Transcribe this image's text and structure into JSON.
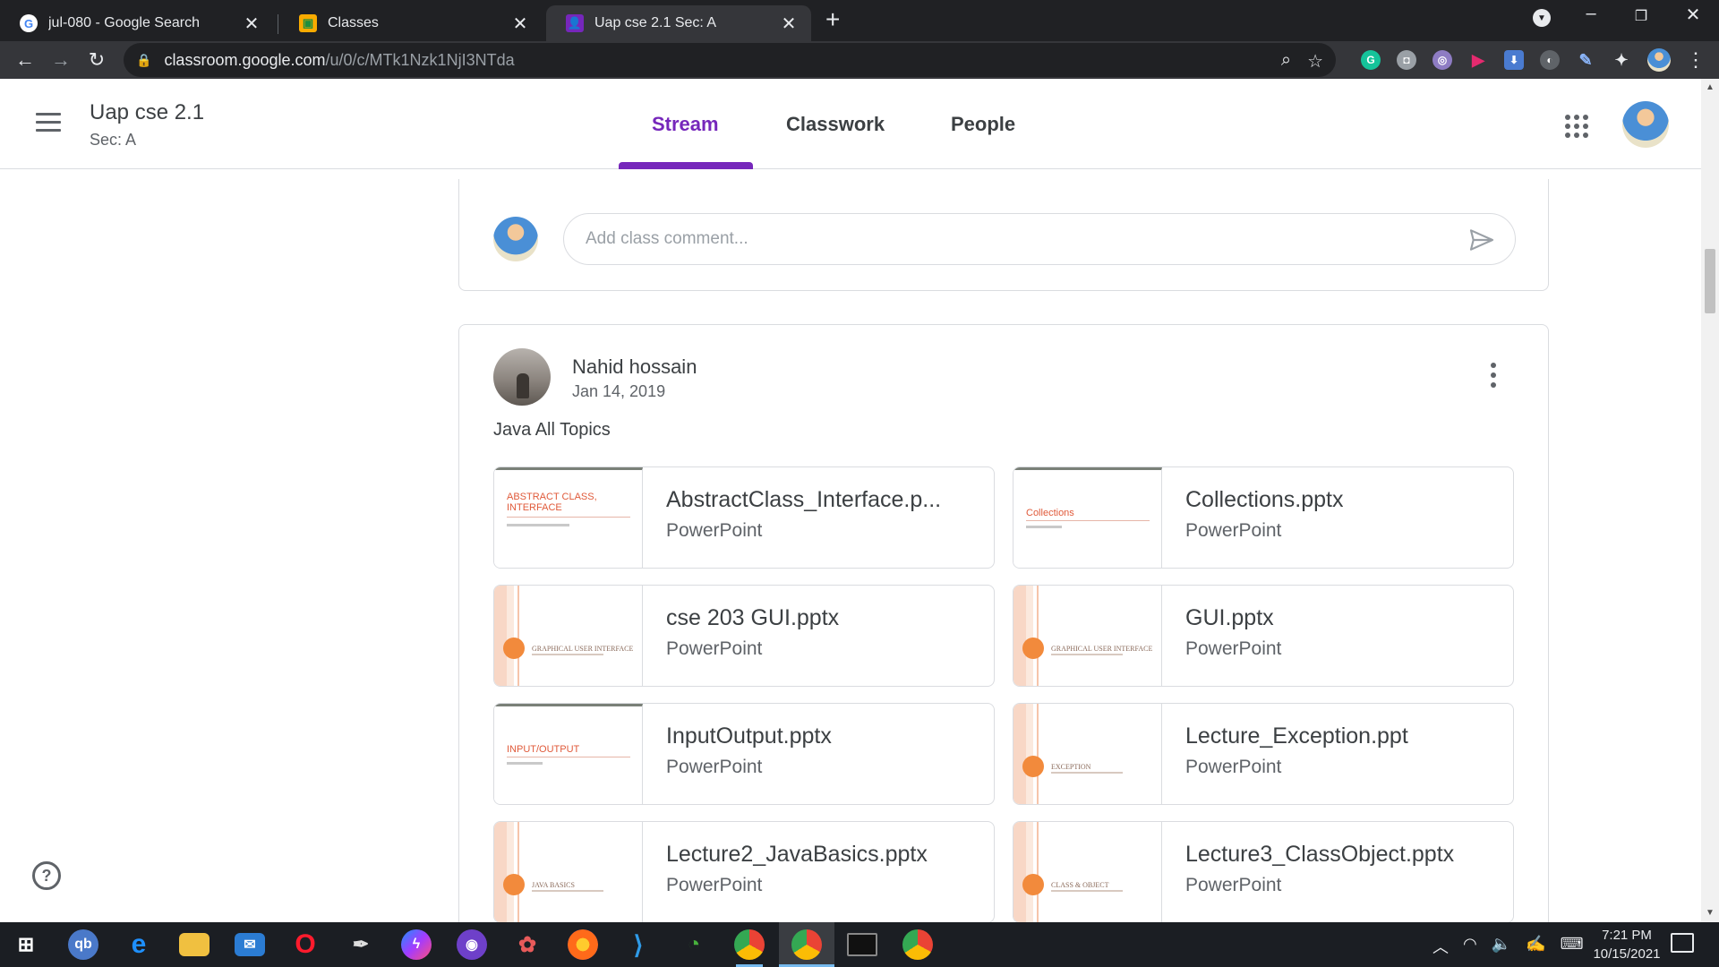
{
  "browser": {
    "tabs": [
      {
        "title": "jul-080 - Google Search",
        "icon": "google-g-icon"
      },
      {
        "title": "Classes",
        "icon": "classroom-icon"
      },
      {
        "title": "Uap cse 2.1 Sec: A",
        "icon": "classroom-person-icon"
      }
    ],
    "url_host": "classroom.google.com",
    "url_path": "/u/0/c/MTk1Nzk1NjI3NTda"
  },
  "classroom": {
    "class_title": "Uap cse 2.1",
    "class_section": "Sec: A",
    "nav_tabs": [
      "Stream",
      "Classwork",
      "People"
    ],
    "active_tab": "Stream",
    "accent_color": "#7627bb",
    "comment_placeholder": "Add class comment...",
    "post": {
      "author": "Nahid hossain",
      "date": "Jan 14, 2019",
      "text": "Java All Topics",
      "attachments": [
        {
          "name": "AbstractClass_Interface.p...",
          "type": "PowerPoint",
          "thumb_title": "ABSTRACT CLASS, INTERFACE"
        },
        {
          "name": "Collections.pptx",
          "type": "PowerPoint",
          "thumb_title": "Collections"
        },
        {
          "name": "cse 203 GUI.pptx",
          "type": "PowerPoint",
          "thumb_title": "Graphical User Interface"
        },
        {
          "name": "GUI.pptx",
          "type": "PowerPoint",
          "thumb_title": "Graphical User Interface"
        },
        {
          "name": "InputOutput.pptx",
          "type": "PowerPoint",
          "thumb_title": "INPUT/OUTPUT"
        },
        {
          "name": "Lecture_Exception.ppt",
          "type": "PowerPoint",
          "thumb_title": "Exception"
        },
        {
          "name": "Lecture2_JavaBasics.pptx",
          "type": "PowerPoint",
          "thumb_title": "Java Basics"
        },
        {
          "name": "Lecture3_ClassObject.pptx",
          "type": "PowerPoint",
          "thumb_title": "Class & Object"
        }
      ]
    }
  },
  "taskbar": {
    "time": "7:21 PM",
    "date": "10/15/2021"
  }
}
